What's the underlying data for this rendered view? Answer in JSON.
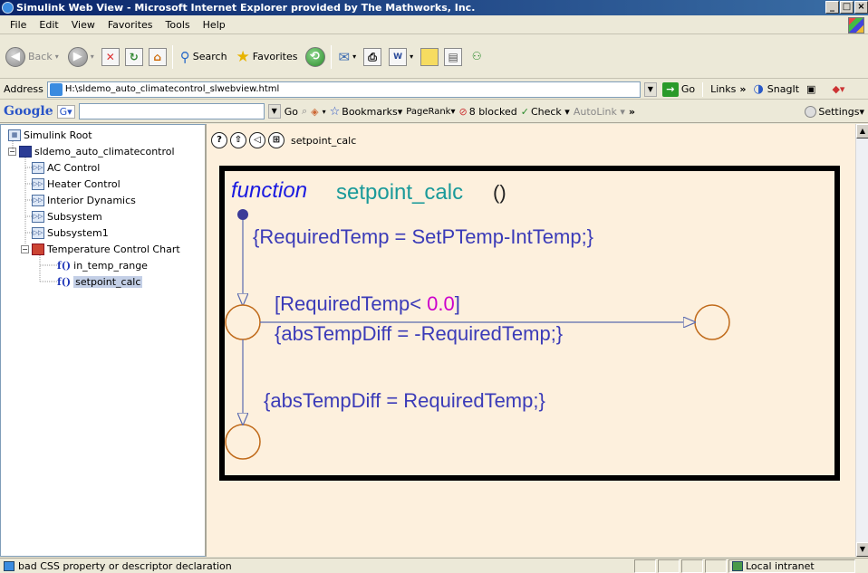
{
  "window": {
    "title": "Simulink Web View - Microsoft Internet Explorer provided by The Mathworks, Inc.",
    "controls": [
      "_",
      "□",
      "×"
    ]
  },
  "menu": [
    "File",
    "Edit",
    "View",
    "Favorites",
    "Tools",
    "Help"
  ],
  "toolbar": {
    "back": "Back",
    "search": "Search",
    "favorites": "Favorites"
  },
  "address": {
    "label": "Address",
    "url": "H:\\sldemo_auto_climatecontrol_slwebview.html",
    "go": "Go",
    "links": "Links",
    "snagit": "SnagIt"
  },
  "google": {
    "logo": "Google",
    "g_button": "G▾",
    "go": "Go",
    "bookmarks": "Bookmarks▾",
    "pagerank": "PageRank▾",
    "blocked": "8 blocked",
    "check": "Check ▾",
    "autolink": "AutoLink ▾",
    "more": "»",
    "settings": "Settings▾"
  },
  "tree": {
    "root": "Simulink Root",
    "model": "sldemo_auto_climatecontrol",
    "items": [
      "AC Control",
      "Heater Control",
      "Interior Dynamics",
      "Subsystem",
      "Subsystem1",
      "Temperature Control Chart"
    ],
    "functions": [
      "in_temp_range",
      "setpoint_calc"
    ],
    "fn_prefix": "f()"
  },
  "diagram": {
    "breadcrumb": "setpoint_calc",
    "nav": [
      "?",
      "⇧",
      "◁",
      "⊞"
    ],
    "keyword": "function",
    "fname": "setpoint_calc",
    "parens": "()",
    "action1": "{RequiredTemp = SetPTemp-IntTemp;}",
    "cond_prefix": "[RequiredTemp< ",
    "cond_value": "0.0",
    "cond_suffix": "]",
    "action2": "{absTempDiff = -RequiredTemp;}",
    "action3": "{absTempDiff = RequiredTemp;}",
    "colors": {
      "keyword": "#1a1ae0",
      "fname": "#1a9a9a",
      "text": "#3b3bb8",
      "number": "#cc00cc",
      "junction": "#c06a1a",
      "transition": "#5a6ab0",
      "frame": "#000000",
      "background": "#FDF0DD"
    }
  },
  "status": {
    "message": "bad CSS property or descriptor declaration",
    "zone": "Local intranet"
  }
}
